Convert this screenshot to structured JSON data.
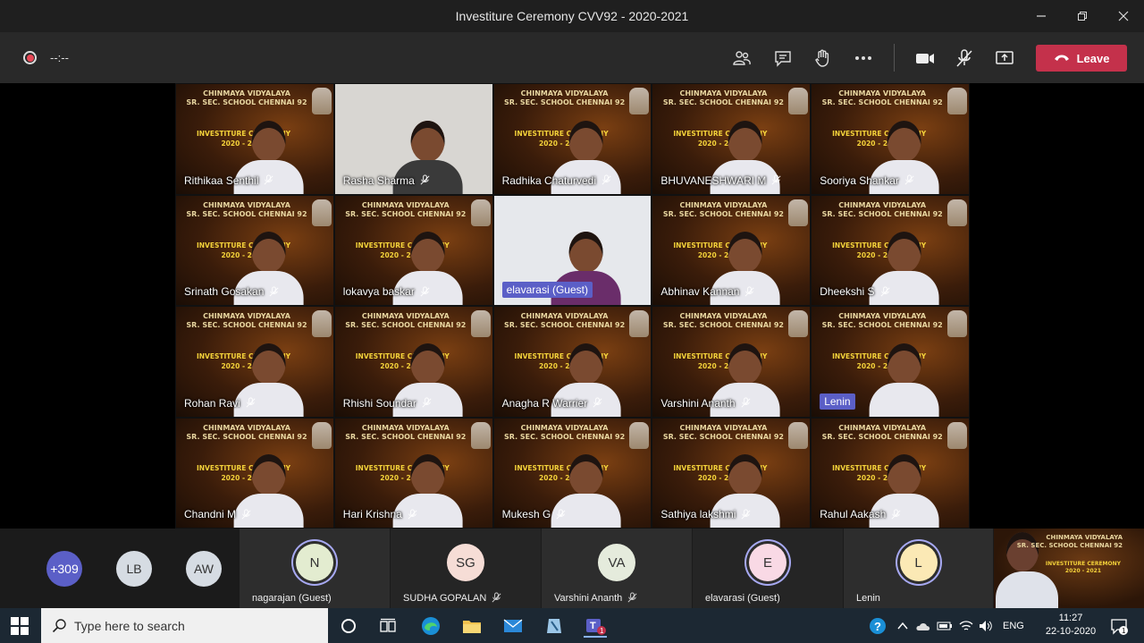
{
  "window": {
    "title": "Investiture Ceremony CVV92 - 2020-2021",
    "controls": [
      "minimize-icon",
      "restore-icon",
      "close-icon"
    ]
  },
  "toolbar": {
    "timer": "--:--",
    "leave_label": "Leave",
    "icons": [
      "participants-icon",
      "chat-icon",
      "raise-hand-icon",
      "more-icon",
      "camera-icon",
      "mic-off-icon",
      "share-screen-icon",
      "phone-hangup-icon"
    ]
  },
  "background": {
    "school_line1": "CHINMAYA VIDYALAYA",
    "school_line2": "SR. SEC. SCHOOL CHENNAI 92",
    "ceremony_line1": "INVESTITURE CEREMONY",
    "ceremony_line2": "2020 - 2021"
  },
  "grid": {
    "participants": [
      {
        "name": "Rithikaa Senthil",
        "muted": true
      },
      {
        "name": "Rasha Sharma",
        "muted": true
      },
      {
        "name": "Radhika Chaturvedi",
        "muted": true
      },
      {
        "name": "BHUVANESHWARI M",
        "muted": true
      },
      {
        "name": "Sooriya Shankar",
        "muted": true
      },
      {
        "name": "Srinath Gosakan",
        "muted": true
      },
      {
        "name": "lokavya baskar",
        "muted": true
      },
      {
        "name": "elavarasi (Guest)",
        "muted": false
      },
      {
        "name": "Abhinav Kannan",
        "muted": true
      },
      {
        "name": "Dheekshi S",
        "muted": true
      },
      {
        "name": "Rohan Ravi",
        "muted": true
      },
      {
        "name": "Rhishi Soundar",
        "muted": true
      },
      {
        "name": "Anagha R Warrier",
        "muted": true
      },
      {
        "name": "Varshini Ananth",
        "muted": true
      },
      {
        "name": "Lenin",
        "muted": false
      },
      {
        "name": "Chandni M",
        "muted": true
      },
      {
        "name": "Hari Krishna",
        "muted": true
      },
      {
        "name": "Mukesh G",
        "muted": true
      },
      {
        "name": "Sathiya lakshmi",
        "muted": true
      },
      {
        "name": "Rahul Aakash",
        "muted": true
      }
    ]
  },
  "strip": {
    "overflow_count": "+309",
    "small_avatars": [
      {
        "initials": "LB",
        "color": "#d6dce3"
      },
      {
        "initials": "AW",
        "color": "#d6dce3"
      }
    ],
    "panels": [
      {
        "initials": "N",
        "name": "nagarajan (Guest)",
        "muted": false,
        "color": "#e3ecd0"
      },
      {
        "initials": "SG",
        "name": "SUDHA GOPALAN",
        "muted": true,
        "color": "#f6ddd6"
      },
      {
        "initials": "VA",
        "name": "Varshini Ananth",
        "muted": true,
        "color": "#e5ebdc"
      },
      {
        "initials": "E",
        "name": "elavarasi (Guest)",
        "muted": false,
        "color": "#f9d9e5"
      },
      {
        "initials": "L",
        "name": "Lenin",
        "muted": false,
        "color": "#fbe9b5"
      }
    ]
  },
  "taskbar": {
    "search_placeholder": "Type here to search",
    "language": "ENG",
    "time": "11:27",
    "date": "22-10-2020",
    "notification_count": "1"
  }
}
